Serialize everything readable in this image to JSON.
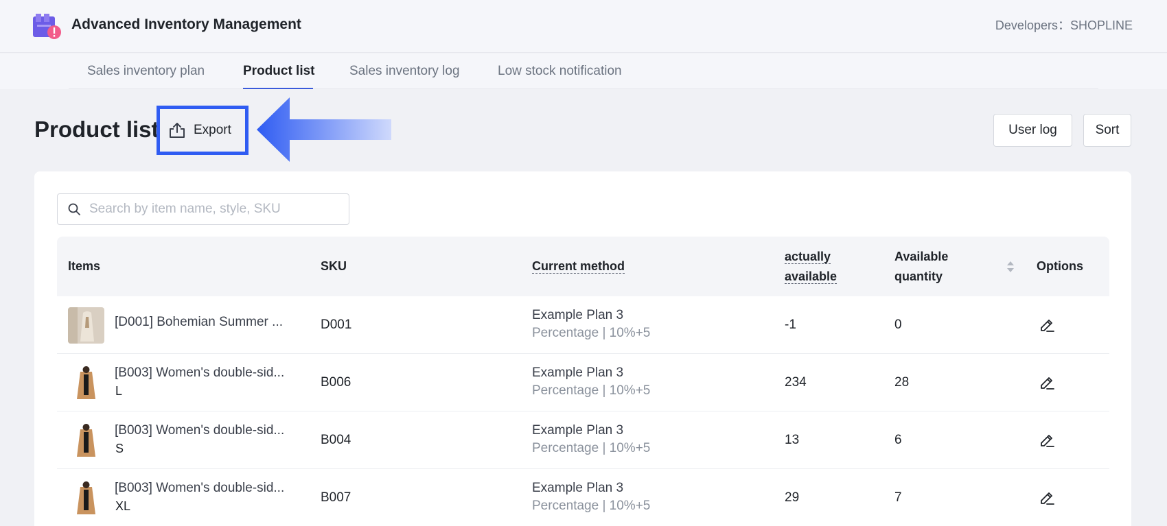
{
  "app": {
    "title": "Advanced Inventory Management",
    "developer": "Developers：SHOPLINE",
    "logo_icon": "inventory-box-alert-icon"
  },
  "tabs": [
    {
      "label": "Sales inventory plan",
      "active": false
    },
    {
      "label": "Product list",
      "active": true
    },
    {
      "label": "Sales inventory log",
      "active": false
    },
    {
      "label": "Low stock notification",
      "active": false
    }
  ],
  "page": {
    "title": "Product list",
    "export_label": "Export",
    "export_icon": "upload-icon",
    "user_log_label": "User log",
    "sort_label": "Sort"
  },
  "search": {
    "placeholder": "Search by item name, style, SKU",
    "value": ""
  },
  "table": {
    "headers": {
      "items": "Items",
      "sku": "SKU",
      "current_method": "Current method",
      "actually_available_1": "actually",
      "actually_available_2": "available",
      "available_quantity_1": "Available",
      "available_quantity_2": "quantity",
      "options": "Options"
    },
    "rows": [
      {
        "name": "[D001] Bohemian Summer ...",
        "variant": "",
        "sku": "D001",
        "plan": "Example Plan 3",
        "plan_detail": "Percentage | 10%+5",
        "actually_available": "-1",
        "available_quantity": "0"
      },
      {
        "name": "[B003] Women's double-sid...",
        "variant": "L",
        "sku": "B006",
        "plan": "Example Plan 3",
        "plan_detail": "Percentage | 10%+5",
        "actually_available": "234",
        "available_quantity": "28"
      },
      {
        "name": "[B003] Women's double-sid...",
        "variant": "S",
        "sku": "B004",
        "plan": "Example Plan 3",
        "plan_detail": "Percentage | 10%+5",
        "actually_available": "13",
        "available_quantity": "6"
      },
      {
        "name": "[B003] Women's double-sid...",
        "variant": "XL",
        "sku": "B007",
        "plan": "Example Plan 3",
        "plan_detail": "Percentage | 10%+5",
        "actually_available": "29",
        "available_quantity": "7"
      }
    ]
  },
  "colors": {
    "accent": "#2f5cf2",
    "tab_underline": "#3b5bdb",
    "background": "#f0f1f5"
  }
}
